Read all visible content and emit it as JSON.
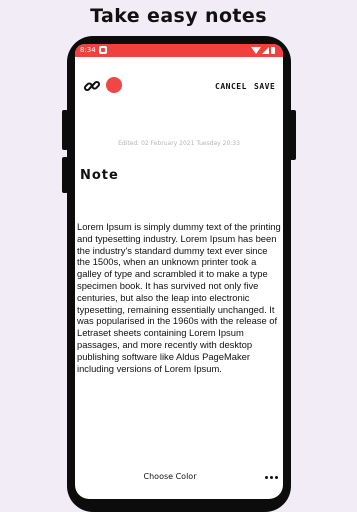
{
  "headline": "Take easy notes",
  "status_bar": {
    "time": "8:34"
  },
  "toolbar": {
    "cancel_label": "CANCEL",
    "save_label": "SAVE"
  },
  "note": {
    "edited": "Edited: 02 February 2021 Tuesday 20:33",
    "title": "Note",
    "body": "Lorem Ipsum is simply dummy text of the printing and typesetting industry. Lorem Ipsum has been the industry's standard dummy text ever since the 1500s, when an unknown printer took a galley of type and scrambled it to make a type specimen book. It has survived not only five centuries, but also the leap into electronic typesetting, remaining essentially unchanged. It was popularised in the 1960s with the release of Letraset sheets containing Lorem Ipsum passages, and more recently with desktop publishing software like Aldus PageMaker including versions of Lorem Ipsum."
  },
  "bottom_bar": {
    "choose_color_label": "Choose Color"
  },
  "colors": {
    "accent": "#f0413f",
    "selected_note_color": "#f04646",
    "background": "#f1ecf6"
  },
  "icons": {
    "link": "link-icon",
    "more": "more-horizontal-icon"
  }
}
